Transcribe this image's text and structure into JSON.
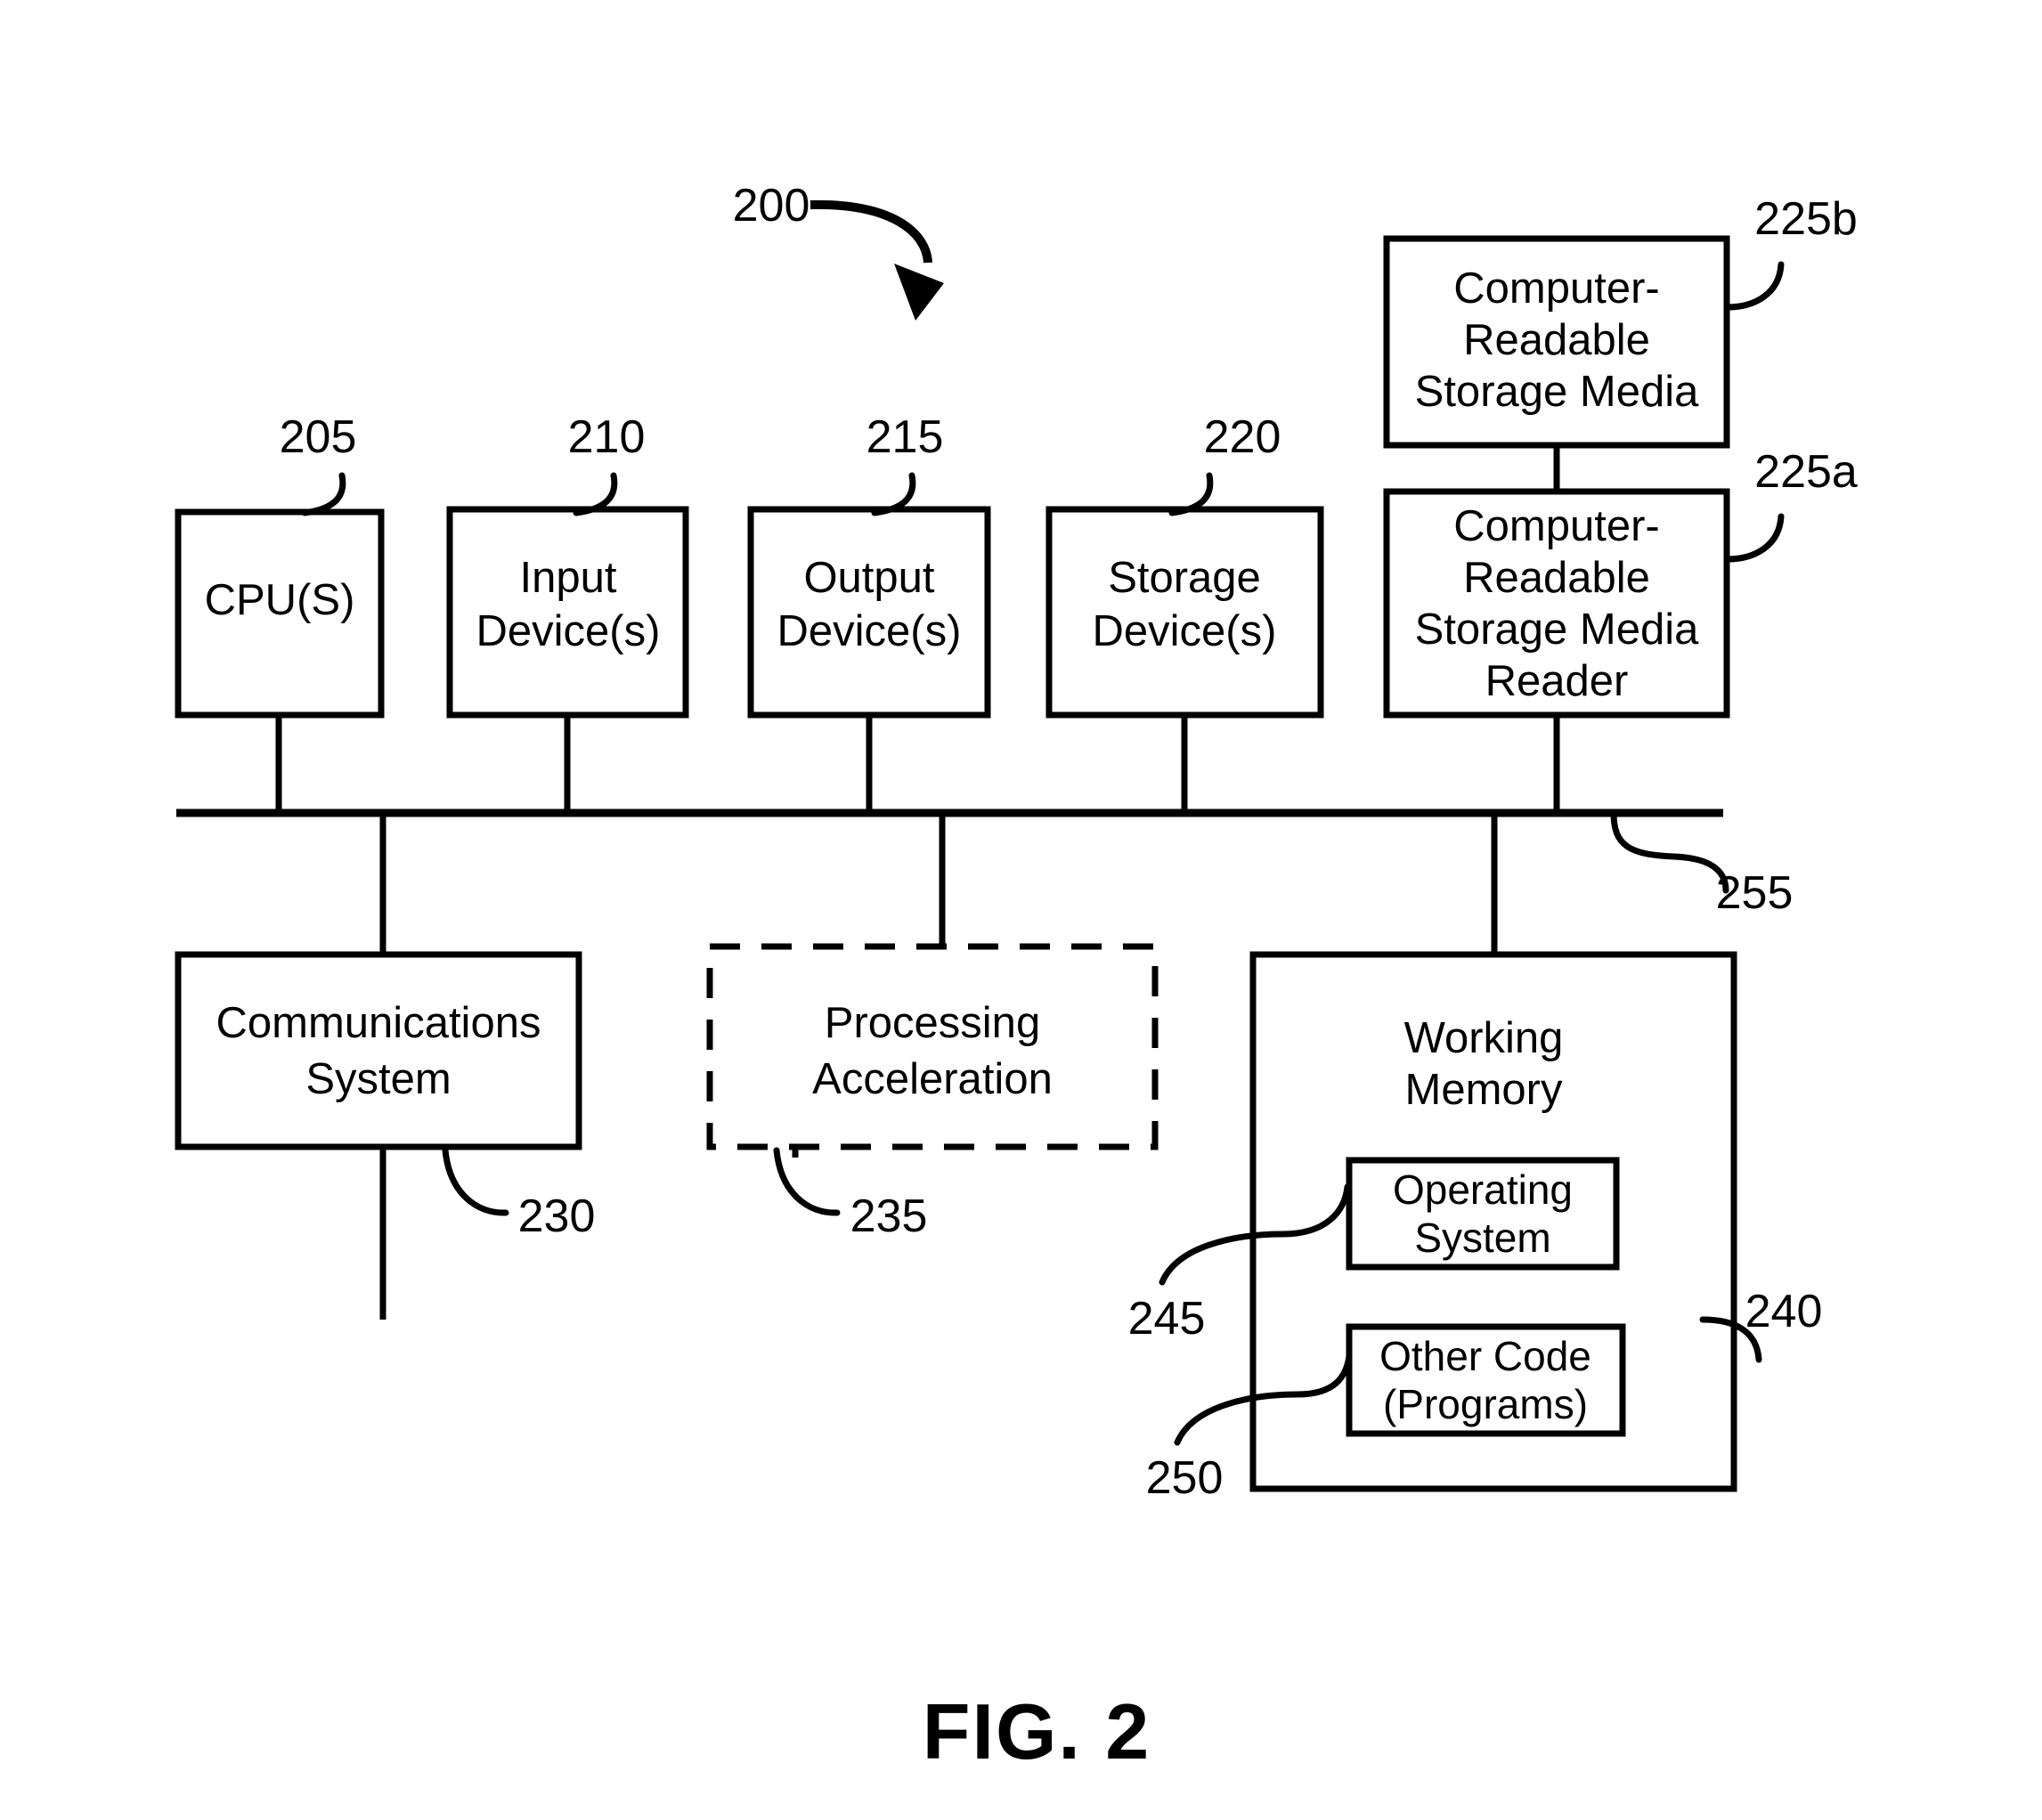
{
  "figure": {
    "caption": "FIG. 2",
    "system_ref": "200"
  },
  "blocks": [
    {
      "id": "cpu",
      "ref": "205",
      "lines": [
        "CPU(S)"
      ],
      "style": "solid"
    },
    {
      "id": "input-devices",
      "ref": "210",
      "lines": [
        "Input",
        "Device(s)"
      ],
      "style": "solid"
    },
    {
      "id": "output-devices",
      "ref": "215",
      "lines": [
        "Output",
        "Device(s)"
      ],
      "style": "solid"
    },
    {
      "id": "storage-devices",
      "ref": "220",
      "lines": [
        "Storage",
        "Device(s)"
      ],
      "style": "solid"
    },
    {
      "id": "crsm",
      "ref": "225b",
      "lines": [
        "Computer-",
        "Readable",
        "Storage Media"
      ],
      "style": "solid"
    },
    {
      "id": "crsm-reader",
      "ref": "225a",
      "lines": [
        "Computer-",
        "Readable",
        "Storage Media",
        "Reader"
      ],
      "style": "solid"
    },
    {
      "id": "communications-system",
      "ref": "230",
      "lines": [
        "Communications",
        "System"
      ],
      "style": "solid"
    },
    {
      "id": "processing-acceleration",
      "ref": "235",
      "lines": [
        "Processing",
        "Acceleration"
      ],
      "style": "dashed"
    },
    {
      "id": "working-memory",
      "ref": "240",
      "lines": [
        "Working",
        "Memory"
      ],
      "style": "solid"
    },
    {
      "id": "operating-system",
      "ref": "245",
      "lines": [
        "Operating",
        "System"
      ],
      "style": "solid"
    },
    {
      "id": "other-code",
      "ref": "250",
      "lines": [
        "Other Code",
        "(Programs)"
      ],
      "style": "solid"
    }
  ],
  "bus": {
    "ref": "255"
  },
  "labels": {
    "cpu_l1": "CPU(S)",
    "input_l1": "Input",
    "input_l2": "Device(s)",
    "output_l1": "Output",
    "output_l2": "Device(s)",
    "storage_l1": "Storage",
    "storage_l2": "Device(s)",
    "crsm_l1": "Computer-",
    "crsm_l2": "Readable",
    "crsm_l3": "Storage Media",
    "reader_l1": "Computer-",
    "reader_l2": "Readable",
    "reader_l3": "Storage Media",
    "reader_l4": "Reader",
    "comms_l1": "Communications",
    "comms_l2": "System",
    "procaccel_l1": "Processing",
    "procaccel_l2": "Acceleration",
    "workmem_l1": "Working",
    "workmem_l2": "Memory",
    "os_l1": "Operating",
    "os_l2": "System",
    "code_l1": "Other Code",
    "code_l2": "(Programs)"
  },
  "refs": {
    "r200": "200",
    "r205": "205",
    "r210": "210",
    "r215": "215",
    "r220": "220",
    "r225a": "225a",
    "r225b": "225b",
    "r230": "230",
    "r235": "235",
    "r240": "240",
    "r245": "245",
    "r250": "250",
    "r255": "255"
  },
  "colors": {
    "stroke": "#000000",
    "background": "#ffffff"
  }
}
